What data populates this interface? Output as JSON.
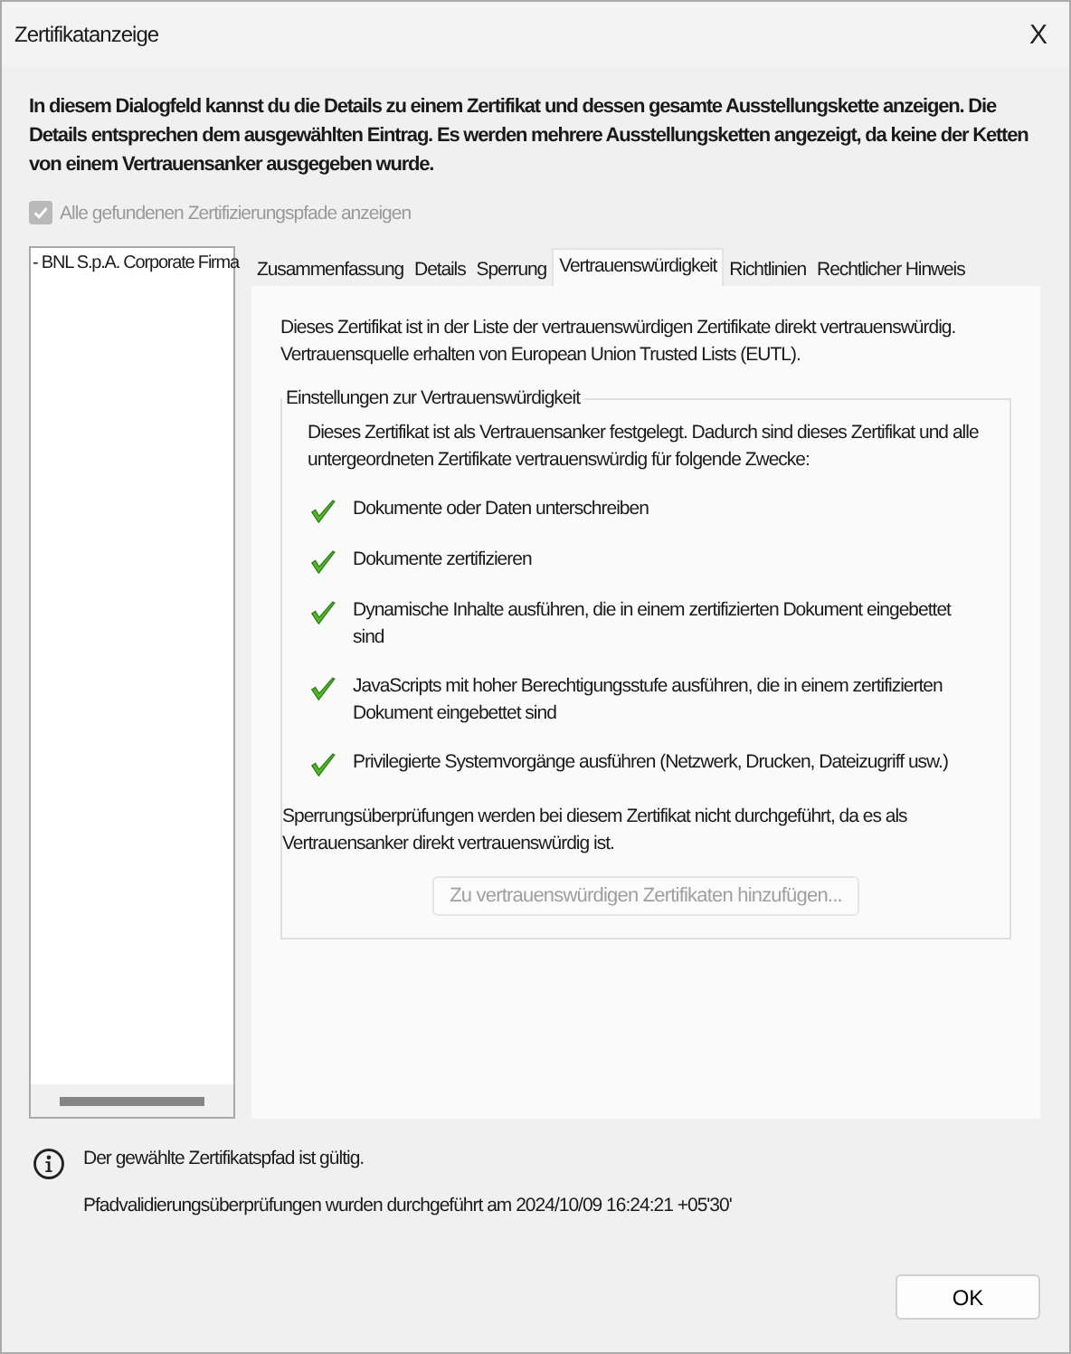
{
  "window": {
    "title": "Zertifikatanzeige",
    "close": "X"
  },
  "intro": "In diesem Dialogfeld kannst du die Details zu einem Zertifikat und dessen gesamte Ausstellungskette anzeigen. Die Details entsprechen dem ausgewählten Eintrag. Es werden mehrere Ausstellungsketten angezeigt, da keine der Ketten von einem Vertrauensanker ausgegeben wurde.",
  "show_all_paths": {
    "label": "Alle gefundenen Zertifizierungspfade anzeigen",
    "checked": true,
    "disabled": true
  },
  "chain": {
    "items": [
      {
        "label": "- BNL S.p.A. Corporate Firma",
        "selected": false
      }
    ]
  },
  "tabs": [
    {
      "label": "Zusammenfassung",
      "selected": false
    },
    {
      "label": "Details",
      "selected": false
    },
    {
      "label": "Sperrung",
      "selected": false
    },
    {
      "label": "Vertrauenswürdigkeit",
      "selected": true
    },
    {
      "label": "Richtlinien",
      "selected": false
    },
    {
      "label": "Rechtlicher Hinweis",
      "selected": false
    }
  ],
  "trust": {
    "summary": "Dieses Zertifikat ist in der Liste der vertrauenswürdigen Zertifikate direkt vertrauenswürdig.  Vertrauensquelle erhalten von European Union Trusted Lists (EUTL).",
    "group_title": "Einstellungen zur Vertrauenswürdigkeit",
    "group_text": "Dieses Zertifikat ist als Vertrauensanker festgelegt. Dadurch sind dieses Zertifikat und alle untergeordneten Zertifikate vertrauenswürdig für folgende Zwecke:",
    "purposes": [
      {
        "label": "Dokumente oder Daten unterschreiben",
        "allowed": true
      },
      {
        "label": "Dokumente zertifizieren",
        "allowed": true
      },
      {
        "label": "Dynamische Inhalte ausführen, die in einem zertifizierten Dokument eingebettet sind",
        "allowed": true
      },
      {
        "label": "JavaScripts mit hoher Berechtigungsstufe ausführen, die in einem zertifizierten Dokument eingebettet sind",
        "allowed": true
      },
      {
        "label": "Privilegierte Systemvorgänge ausführen (Netzwerk, Drucken, Dateizugriff usw.)",
        "allowed": true
      }
    ],
    "revocation_note": "Sperrungsüberprüfungen werden bei diesem Zertifikat nicht durchgeführt, da es als Vertrauensanker direkt vertrauenswürdig ist.",
    "add_button": {
      "label": "Zu vertrauenswürdigen Zertifikaten hinzufügen...",
      "disabled": true
    }
  },
  "status": {
    "valid_text": "Der gewählte Zertifikatspfad ist gültig.",
    "validation_text": "Pfadvalidierungsüberprüfungen wurden durchgeführt am 2024/10/09 16:24:21 +05'30'"
  },
  "buttons": [
    {
      "label": "OK"
    }
  ]
}
